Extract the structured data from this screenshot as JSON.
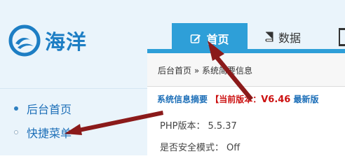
{
  "logo": {
    "text": "海洋",
    "colors": {
      "primary": "#1d7ec4"
    }
  },
  "tabs": [
    {
      "label": "首页",
      "icon": "edit-icon",
      "active": true
    },
    {
      "label": "数据",
      "icon": "book-icon",
      "active": false
    }
  ],
  "breadcrumb": {
    "home": "后台首页",
    "separator": "»",
    "current": "系统简要信息"
  },
  "summary": {
    "title": "系统信息摘要",
    "version_label": "【当前版本：",
    "version": "V6.46",
    "latest": "最新版"
  },
  "sidebar": {
    "items": [
      {
        "label": "后台首页",
        "bullet": "filled"
      },
      {
        "label": "快捷菜单",
        "bullet": "hollow"
      }
    ]
  },
  "info": [
    {
      "label": "PHP版本：",
      "value": "5.5.37"
    },
    {
      "label": "是否安全模式：",
      "value": "Off"
    }
  ],
  "colors": {
    "accent": "#2e9fd8",
    "link": "#1d6fb8",
    "version": "#cc1111",
    "arrow": "#8b1a1a"
  }
}
